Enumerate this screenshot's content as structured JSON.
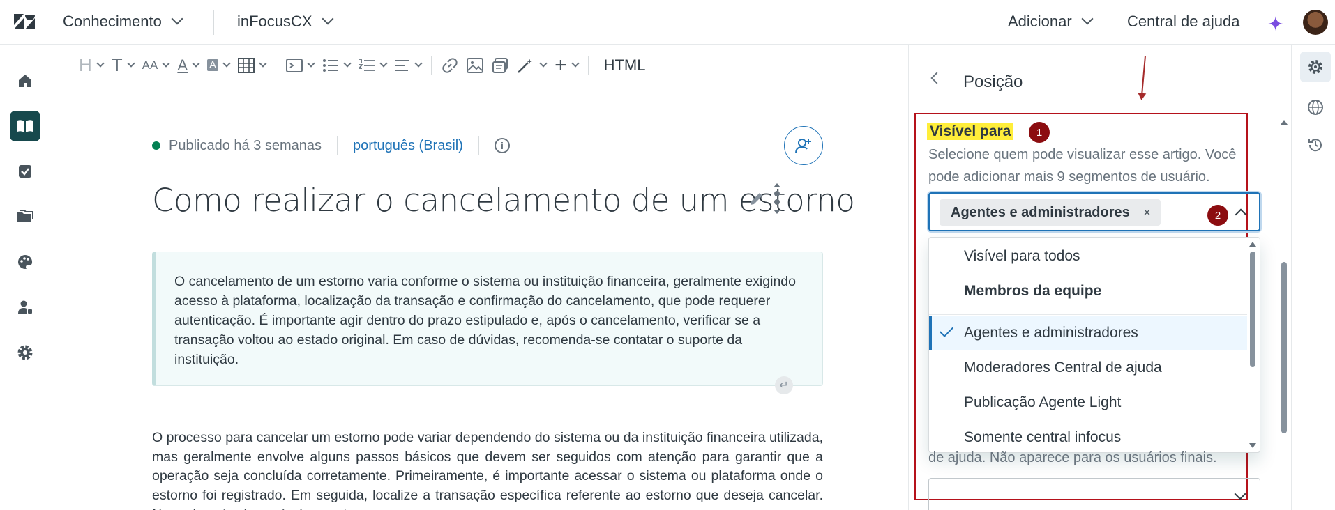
{
  "topbar": {
    "product_menu": "Conhecimento",
    "brand_menu": "inFocusCX",
    "add_menu": "Adicionar",
    "help_center": "Central de ajuda"
  },
  "leftnav": [
    "home-icon",
    "knowledge-icon",
    "tasks-icon",
    "folders-icon",
    "themes-icon",
    "user-permissions-icon",
    "settings-icon"
  ],
  "toolbar": {
    "html_label": "HTML"
  },
  "article": {
    "status": "Publicado há 3 semanas",
    "language": "português (Brasil)",
    "info_glyph": "i",
    "title": "Como realizar o cancelamento de um estorno",
    "summary": "O cancelamento de um estorno varia conforme o sistema ou instituição financeira, geralmente exigindo acesso à plataforma, localização da transação e confirmação do cancelamento, que pode requerer autenticação. É importante agir dentro do prazo estipulado e, após o cancelamento, verificar se a transação voltou ao estado original. Em caso de dúvidas, recomenda-se contatar o suporte da instituição.",
    "return_glyph": "↵",
    "body": "O processo para cancelar um estorno pode variar dependendo do sistema ou da instituição financeira utilizada, mas geralmente envolve alguns passos básicos que devem ser seguidos com atenção para garantir que a operação seja concluída corretamente. Primeiramente, é importante acessar o sistema ou plataforma onde o estorno foi registrado. Em seguida, localize a transação específica referente ao estorno que deseja cancelar. Normalmente, é possível encontrar"
  },
  "panel": {
    "title": "Posição",
    "field_label": "Visível para",
    "field_hint": "Selecione quem pode visualizar esse artigo. Você pode adicionar mais 9 segmentos de usuário.",
    "selected_tag": "Agentes e administradores",
    "tag_remove": "×",
    "badge1": "1",
    "badge2": "2",
    "options": [
      {
        "label": "Visível para todos",
        "bold": false,
        "selected": false
      },
      {
        "label": "Membros da equipe",
        "bold": true,
        "selected": false
      },
      {
        "label": "Agentes e administradores",
        "bold": false,
        "selected": true
      },
      {
        "label": "Moderadores Central de ajuda",
        "bold": false,
        "selected": false
      },
      {
        "label": "Publicação Agente Light",
        "bold": false,
        "selected": false
      },
      {
        "label": "Somente central infocus",
        "bold": false,
        "selected": false
      }
    ],
    "below_hint": "de ajuda. Não aparece para os usuários finais."
  },
  "rail": [
    "settings-icon",
    "globe-icon",
    "history-icon"
  ],
  "colors": {
    "accent": "#1f73b7",
    "annotation_red": "#b5121b",
    "highlight_yellow": "#ffee3a",
    "published_green": "#038153"
  }
}
